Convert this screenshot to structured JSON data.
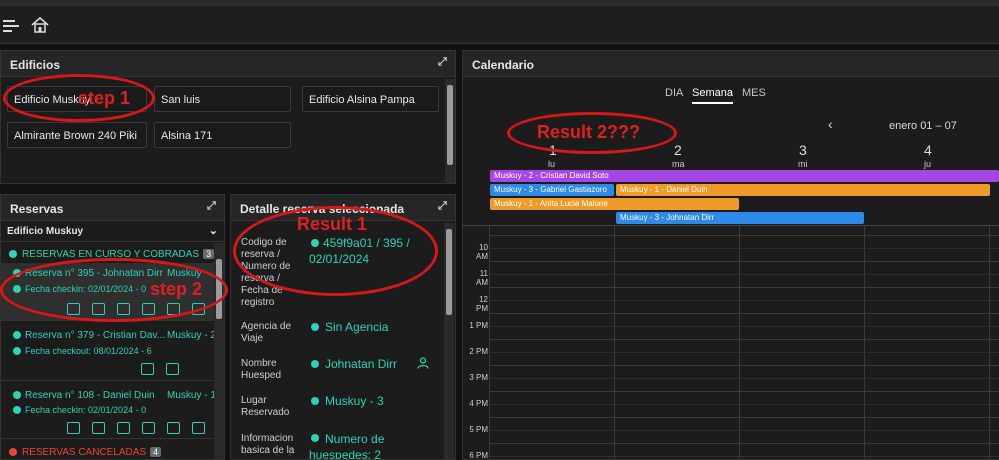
{
  "edificios": {
    "title": "Edificios",
    "items": [
      "Edificio Muskuy",
      "San luis",
      "Edificio Alsina Pampa",
      "Almirante Brown 240 Piki",
      "Alsina 171"
    ]
  },
  "reservas": {
    "title": "Reservas",
    "building": "Edificio Muskuy",
    "section_current": "RESERVAS EN CURSO Y COBRADAS",
    "section_current_count": "3",
    "section_cancelled": "RESERVAS CANCELADAS",
    "section_cancelled_count": "4",
    "items": [
      {
        "title": "Reserva n° 395 - Johnatan Dirr",
        "place": "Muskuy -",
        "date": "Fecha checkin: 02/01/2024 - 0"
      },
      {
        "title": "Reserva n° 379 - Cristian Dav...",
        "place": "Muskuy - 2",
        "date": "Fecha checkout: 08/01/2024 - 6"
      },
      {
        "title": "Reserva n° 108 - Daniel Duin",
        "place": "Muskuy - 1",
        "date": "Fecha checkin: 02/01/2024 - 0"
      }
    ]
  },
  "detalle": {
    "title": "Detalle reserva seleccionada",
    "rows": [
      {
        "label": "Codigo de reserva / Numero de reserva / Fecha de registro",
        "value": "459f9a01 / 395 / 02/01/2024"
      },
      {
        "label": "Agencia de Viaje",
        "value": "Sin Agencia"
      },
      {
        "label": "Nombre Huesped",
        "value": "Johnatan Dirr"
      },
      {
        "label": "Lugar Reservado",
        "value": "Muskuy - 3"
      },
      {
        "label": "Informacion basica de la reserva",
        "value": "Numero de huespedes: 2"
      }
    ]
  },
  "calendario": {
    "title": "Calendario",
    "tabs": [
      "DIA",
      "Semana",
      "MES"
    ],
    "range": "enero 01 – 07",
    "days": [
      {
        "num": "1",
        "name": "lu"
      },
      {
        "num": "2",
        "name": "ma"
      },
      {
        "num": "3",
        "name": "mi"
      },
      {
        "num": "4",
        "name": "ju"
      }
    ],
    "events": [
      "Muskuy - 2 - Cristian David Soto",
      "Muskuy - 3 - Gabriel Gastiazoro",
      "Muskuy - 1 - Daniel Duin",
      "Muskuy - 1 - Anita Lucia Malone",
      "Muskuy - 3 - Johnatan Dirr"
    ],
    "hours": [
      "10 AM",
      "11 AM",
      "12 PM",
      "1 PM",
      "2 PM",
      "3 PM",
      "4 PM",
      "5 PM",
      "6 PM"
    ]
  },
  "annotations": {
    "step1": "step 1",
    "step2": "step 2",
    "result1": "Result 1",
    "result2": "Result 2???"
  }
}
